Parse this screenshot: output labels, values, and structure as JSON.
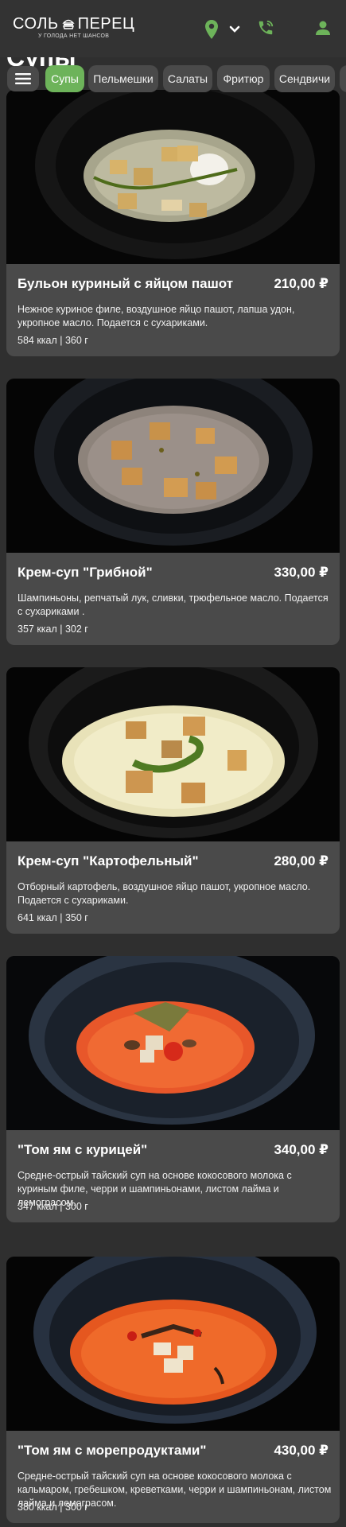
{
  "header": {
    "logo_title_left": "СОЛЬ",
    "logo_title_right": "ПЕРЕЦ",
    "logo_tagline": "У ГОЛОДА НЕТ ШАНСОВ",
    "icons": [
      "location-pin-icon",
      "chevron-down-icon",
      "phone-icon",
      "user-icon"
    ],
    "accent_color": "#6db35a"
  },
  "section_title": "Супы",
  "categories": [
    {
      "label": "Супы",
      "active": true
    },
    {
      "label": "Пельмешки",
      "active": false
    },
    {
      "label": "Салаты",
      "active": false
    },
    {
      "label": "Фритюр",
      "active": false
    },
    {
      "label": "Сендвичи",
      "active": false
    }
  ],
  "products": [
    {
      "name": "Бульон куриный с яйцом пашот",
      "price": "210,00 ₽",
      "description": "Нежное куриное филе, воздушное яйцо пашот,  лапша удон, укропное масло. Подается с сухариками.",
      "meta": "584 ккал | 360 г",
      "photo": "bowl-chicken-broth"
    },
    {
      "name": "Крем-суп \"Грибной\"",
      "price": "330,00 ₽",
      "description": "Шампиньоны, репчатый лук, сливки, трюфельное масло. Подается с сухариками .",
      "meta": "357 ккал | 302 г",
      "photo": "bowl-mushroom-cream-soup"
    },
    {
      "name": "Крем-суп \"Картофельный\"",
      "price": "280,00 ₽",
      "description": "Отборный картофель, воздушное яйцо пашот, укропное масло. Подается с сухариками.",
      "meta": "641 ккал | 350 г",
      "photo": "bowl-potato-cream-soup"
    },
    {
      "name": "\"Том ям с курицей\"",
      "price": "340,00 ₽",
      "description": "Средне-острый тайский суп на основе кокосового молока с куриным филе, черри и шампиньонами, листом лайма и лемограсом.",
      "meta": "347 ккал | 300 г",
      "photo": "bowl-tom-yum-chicken"
    },
    {
      "name": "\"Том ям с морепродуктами\"",
      "price": "430,00 ₽",
      "description": "Средне-острый тайский суп на основе кокосового молока с кальмаром, гребешком, креветками, черри и шампиньонам, листом лайма и лемограсом.",
      "meta": "380 ккал | 300 г",
      "photo": "bowl-tom-yum-seafood"
    }
  ]
}
